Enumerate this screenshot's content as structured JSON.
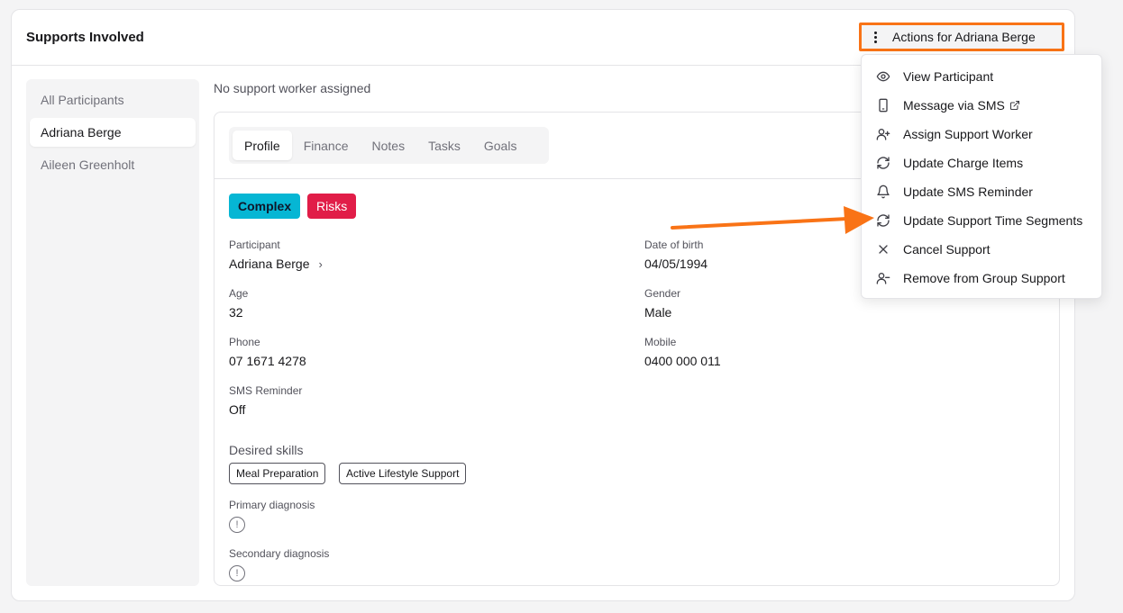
{
  "header": {
    "title": "Supports Involved",
    "actions_label": "Actions for Adriana Berge"
  },
  "sidebar": {
    "items": [
      {
        "label": "All Participants"
      },
      {
        "label": "Adriana Berge"
      },
      {
        "label": "Aileen Greenholt"
      }
    ]
  },
  "main": {
    "no_worker": "No support worker assigned",
    "tabs": [
      "Profile",
      "Finance",
      "Notes",
      "Tasks",
      "Goals"
    ],
    "badges": {
      "complex": "Complex",
      "risks": "Risks"
    },
    "fields": {
      "participant": {
        "label": "Participant",
        "value": "Adriana Berge"
      },
      "dob": {
        "label": "Date of birth",
        "value": "04/05/1994"
      },
      "age": {
        "label": "Age",
        "value": "32"
      },
      "gender": {
        "label": "Gender",
        "value": "Male"
      },
      "phone": {
        "label": "Phone",
        "value": "07 1671 4278"
      },
      "mobile": {
        "label": "Mobile",
        "value": "0400 000 011"
      },
      "sms": {
        "label": "SMS Reminder",
        "value": "Off"
      },
      "primary": {
        "label": "Primary diagnosis"
      },
      "secondary": {
        "label": "Secondary diagnosis"
      }
    },
    "skills": {
      "label": "Desired skills",
      "items": [
        "Meal Preparation",
        "Active Lifestyle Support"
      ]
    }
  },
  "menu": {
    "items": [
      {
        "label": "View Participant",
        "icon": "eye-icon"
      },
      {
        "label": "Message via SMS",
        "icon": "phone-icon"
      },
      {
        "label": "Assign Support Worker",
        "icon": "user-plus-icon"
      },
      {
        "label": "Update Charge Items",
        "icon": "refresh-icon"
      },
      {
        "label": "Update SMS Reminder",
        "icon": "bell-icon"
      },
      {
        "label": "Update Support Time Segments",
        "icon": "refresh-icon"
      },
      {
        "label": "Cancel Support",
        "icon": "close-icon"
      },
      {
        "label": "Remove from Group Support",
        "icon": "user-minus-icon"
      }
    ]
  },
  "colors": {
    "highlight": "#f97316",
    "complex": "#06b6d4",
    "risks": "#e11d48"
  }
}
